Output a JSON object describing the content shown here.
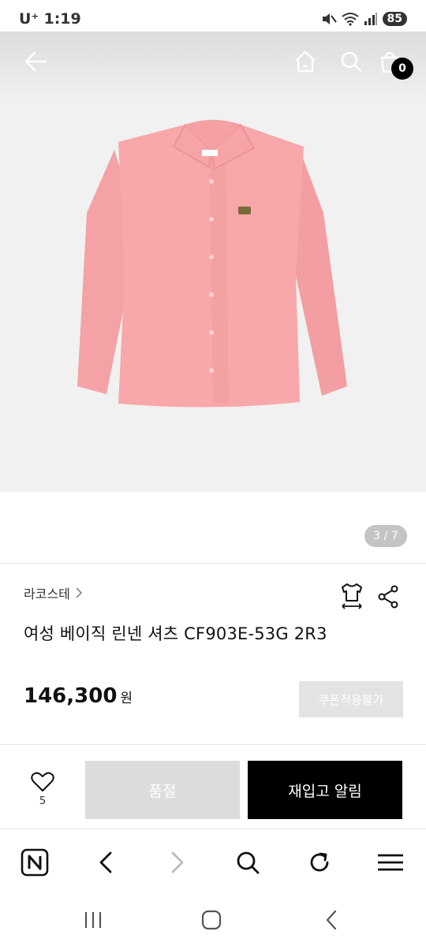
{
  "status": {
    "carrier": "U⁺",
    "time": "1:19",
    "battery": "85"
  },
  "header": {
    "cart_count": "0"
  },
  "gallery": {
    "counter": "3 / 7"
  },
  "product": {
    "brand": "라코스테",
    "title": "여성 베이직 린넨 셔츠 CF903E-53G 2R3",
    "price": "146,300",
    "price_unit": "원",
    "coupon_label": "쿠폰적용불가"
  },
  "actions": {
    "like_count": "5",
    "soldout_label": "품절",
    "restock_label": "재입고 알림"
  },
  "colors": {
    "shirt": "#f7a3a6",
    "accent_black": "#000000",
    "disabled_gray": "#dcdcdc"
  }
}
